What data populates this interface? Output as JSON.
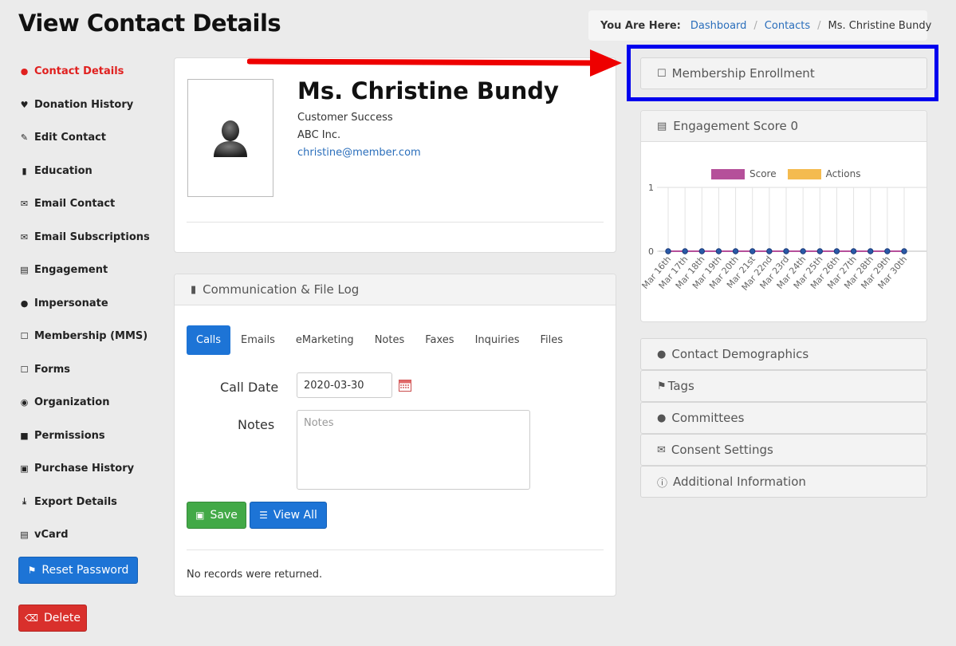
{
  "header": {
    "title": "View Contact Details"
  },
  "breadcrumb": {
    "label": "You Are Here:",
    "items": [
      "Dashboard",
      "Contacts"
    ],
    "current": "Ms. Christine Bundy"
  },
  "sidebar": {
    "items": [
      {
        "label": "Contact Details",
        "icon": "user-icon",
        "active": true
      },
      {
        "label": "Donation History",
        "icon": "heart-icon"
      },
      {
        "label": "Edit Contact",
        "icon": "edit-icon"
      },
      {
        "label": "Education",
        "icon": "book-icon"
      },
      {
        "label": "Email Contact",
        "icon": "envelope-icon"
      },
      {
        "label": "Email Subscriptions",
        "icon": "envelope-icon"
      },
      {
        "label": "Engagement",
        "icon": "bar-chart-icon"
      },
      {
        "label": "Impersonate",
        "icon": "user-icon"
      },
      {
        "label": "Membership (MMS)",
        "icon": "bookmark-icon"
      },
      {
        "label": "Forms",
        "icon": "bookmark-icon"
      },
      {
        "label": "Organization",
        "icon": "eye-icon"
      },
      {
        "label": "Permissions",
        "icon": "lock-icon"
      },
      {
        "label": "Purchase History",
        "icon": "money-icon"
      },
      {
        "label": "Export Details",
        "icon": "download-icon"
      },
      {
        "label": "vCard",
        "icon": "vcard-icon"
      }
    ],
    "reset_password": "Reset Password",
    "delete": "Delete"
  },
  "contact": {
    "name": "Ms. Christine Bundy",
    "title": "Customer Success",
    "company": "ABC Inc.",
    "email": "christine@member.com"
  },
  "comm_log": {
    "heading": "Communication & File Log",
    "tabs": [
      "Calls",
      "Emails",
      "eMarketing",
      "Notes",
      "Faxes",
      "Inquiries",
      "Files"
    ],
    "call_date_label": "Call Date",
    "call_date_value": "2020-03-30",
    "notes_label": "Notes",
    "notes_placeholder": "Notes",
    "save": "Save",
    "view_all": "View All",
    "empty": "No records were returned."
  },
  "right": {
    "membership_enrollment": "Membership Enrollment",
    "engagement_heading": "Engagement Score 0",
    "collapsibles": [
      {
        "label": "Contact Demographics",
        "icon": "user-icon"
      },
      {
        "label": "Tags",
        "icon": "tags-icon"
      },
      {
        "label": "Committees",
        "icon": "users-icon"
      },
      {
        "label": "Consent Settings",
        "icon": "envelope-icon"
      },
      {
        "label": "Additional Information",
        "icon": "info-icon"
      }
    ]
  },
  "colors": {
    "score": "#b5509a",
    "actions": "#f4bb4f",
    "accent": "#1d74d6",
    "annotation_arrow": "#ee0000",
    "highlight_box": "#0000ee"
  },
  "chart_data": {
    "type": "line",
    "x": [
      "Mar 16th",
      "Mar 17th",
      "Mar 18th",
      "Mar 19th",
      "Mar 20th",
      "Mar 21st",
      "Mar 22nd",
      "Mar 23rd",
      "Mar 24th",
      "Mar 25th",
      "Mar 26th",
      "Mar 27th",
      "Mar 28th",
      "Mar 29th",
      "Mar 30th"
    ],
    "series": [
      {
        "name": "Score",
        "values": [
          0,
          0,
          0,
          0,
          0,
          0,
          0,
          0,
          0,
          0,
          0,
          0,
          0,
          0,
          0
        ]
      },
      {
        "name": "Actions",
        "values": [
          0,
          0,
          0,
          0,
          0,
          0,
          0,
          0,
          0,
          0,
          0,
          0,
          0,
          0,
          0
        ]
      }
    ],
    "yticks": [
      "0",
      "1"
    ],
    "ylim": [
      0,
      1
    ],
    "legend": "top"
  }
}
